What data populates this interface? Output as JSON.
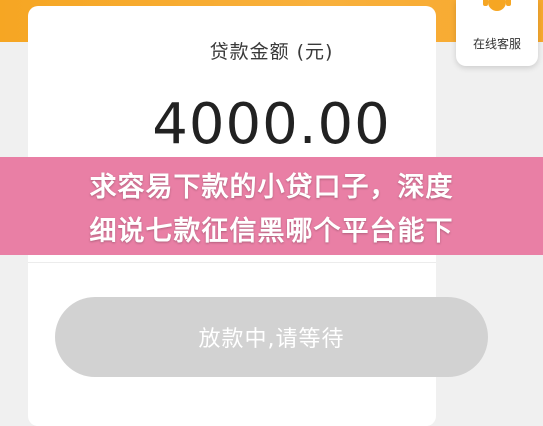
{
  "loan": {
    "label": "贷款金额 (元)",
    "amount": "4000.00"
  },
  "service": {
    "label": "在线客服",
    "icon": "customer-service-icon"
  },
  "banner": {
    "line1": "求容易下款的小贷口子，深度",
    "line2": "细说七款征信黑哪个平台能下"
  },
  "button": {
    "label": "放款中,请等待"
  },
  "colors": {
    "accent": "#f6a623",
    "banner": "#e878a0",
    "button_disabled": "#d2d2d2"
  }
}
